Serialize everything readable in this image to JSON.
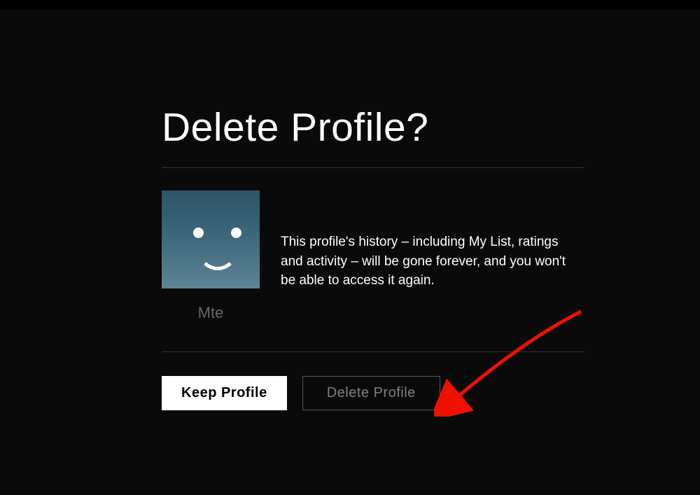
{
  "dialog": {
    "title": "Delete Profile?",
    "description": "This profile's history – including My List, ratings and activity – will be gone forever, and you won't be able to access it again."
  },
  "profile": {
    "name": "Mte"
  },
  "buttons": {
    "keep_label": "Keep Profile",
    "delete_label": "Delete Profile"
  }
}
